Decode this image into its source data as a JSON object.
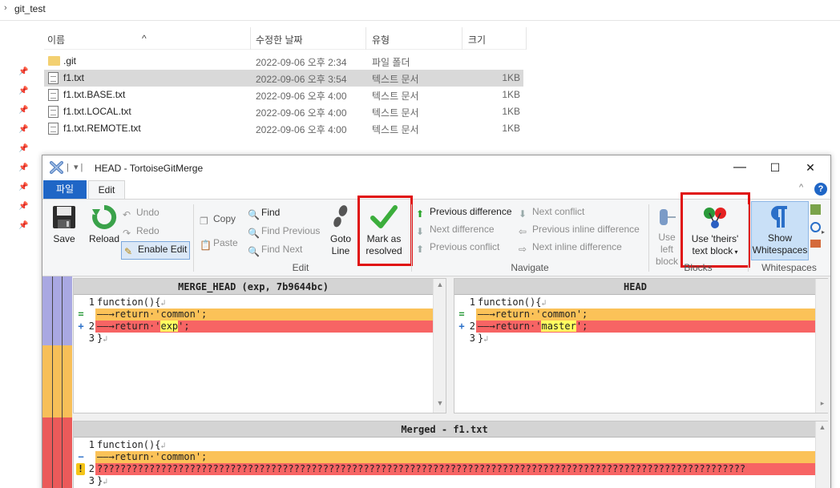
{
  "explorer": {
    "breadcrumb": "git_test",
    "columns": {
      "name": "이름",
      "modified": "수정한 날짜",
      "type": "유형",
      "size": "크기"
    },
    "files": [
      {
        "name": ".git",
        "modified": "2022-09-06 오후 2:34",
        "type": "파일 폴더",
        "size": "",
        "kind": "folder",
        "selected": false
      },
      {
        "name": "f1.txt",
        "modified": "2022-09-06 오후 3:54",
        "type": "텍스트 문서",
        "size": "1KB",
        "kind": "file",
        "selected": true
      },
      {
        "name": "f1.txt.BASE.txt",
        "modified": "2022-09-06 오후 4:00",
        "type": "텍스트 문서",
        "size": "1KB",
        "kind": "file",
        "selected": false
      },
      {
        "name": "f1.txt.LOCAL.txt",
        "modified": "2022-09-06 오후 4:00",
        "type": "텍스트 문서",
        "size": "1KB",
        "kind": "file",
        "selected": false
      },
      {
        "name": "f1.txt.REMOTE.txt",
        "modified": "2022-09-06 오후 4:00",
        "type": "텍스트 문서",
        "size": "1KB",
        "kind": "file",
        "selected": false
      }
    ]
  },
  "window": {
    "title": "HEAD - TortoiseGitMerge",
    "tabs": {
      "file": "파일",
      "edit": "Edit"
    },
    "controls": {
      "minimize": "—",
      "maximize": "☐",
      "close": "✕"
    }
  },
  "ribbon": {
    "save": "Save",
    "reload": "Reload",
    "undo": "Undo",
    "redo": "Redo",
    "enable_edit": "Enable Edit",
    "copy": "Copy",
    "paste": "Paste",
    "find": "Find",
    "find_previous": "Find Previous",
    "find_next": "Find Next",
    "goto_line_1": "Goto",
    "goto_line_2": "Line",
    "mark_resolved_1": "Mark as",
    "mark_resolved_2": "resolved",
    "previous_difference": "Previous difference",
    "next_difference": "Next difference",
    "previous_conflict": "Previous conflict",
    "next_conflict": "Next conflict",
    "previous_inline": "Previous inline difference",
    "next_inline": "Next inline difference",
    "use_left_1": "Use left",
    "use_left_2": "block",
    "use_theirs_1": "Use 'theirs'",
    "use_theirs_2": "text block",
    "show_ws_1": "Show",
    "show_ws_2": "Whitespaces",
    "group_edit": "Edit",
    "group_navigate": "Navigate",
    "group_blocks": "Blocks",
    "group_whitespaces": "Whitespaces"
  },
  "panes": {
    "left": {
      "title": "MERGE_HEAD (exp, 7b9644bc)",
      "lines": [
        {
          "num": "1",
          "marker": "",
          "kind": "plain",
          "pre": "function(){",
          "hl": "",
          "post": ""
        },
        {
          "num": "",
          "marker": "=",
          "kind": "yel",
          "pre": "——→return·'common';",
          "hl": "",
          "post": ""
        },
        {
          "num": "2",
          "marker": "+",
          "kind": "red",
          "pre": "——→return·'",
          "hl": "exp",
          "post": "';"
        },
        {
          "num": "3",
          "marker": "",
          "kind": "plain",
          "pre": "}",
          "hl": "",
          "post": ""
        }
      ]
    },
    "right": {
      "title": "HEAD",
      "lines": [
        {
          "num": "1",
          "marker": "",
          "kind": "plain",
          "pre": "function(){",
          "hl": "",
          "post": ""
        },
        {
          "num": "",
          "marker": "=",
          "kind": "yel",
          "pre": "——→return·'common';",
          "hl": "",
          "post": ""
        },
        {
          "num": "2",
          "marker": "+",
          "kind": "red",
          "pre": "——→return·'",
          "hl": "master",
          "post": "';"
        },
        {
          "num": "3",
          "marker": "",
          "kind": "plain",
          "pre": "}",
          "hl": "",
          "post": ""
        }
      ]
    },
    "merged": {
      "title": "Merged - f1.txt",
      "lines": [
        {
          "num": "1",
          "marker": "",
          "kind": "plain",
          "pre": "function(){",
          "hl": "",
          "post": ""
        },
        {
          "num": "",
          "marker": "−",
          "kind": "yel",
          "pre": "——→return·'common';",
          "hl": "",
          "post": ""
        },
        {
          "num": "2",
          "marker": "!",
          "kind": "red",
          "pre": "????????????????????????????????????????????????????????????????????????????????????????????????????????????????",
          "hl": "",
          "post": ""
        },
        {
          "num": "3",
          "marker": "",
          "kind": "plain",
          "pre": "}",
          "hl": "",
          "post": ""
        }
      ]
    }
  },
  "colors": {
    "conflict": "#f76464",
    "changed": "#fbc258",
    "accent": "#1f66c6",
    "highlight_box": "#e01010"
  }
}
